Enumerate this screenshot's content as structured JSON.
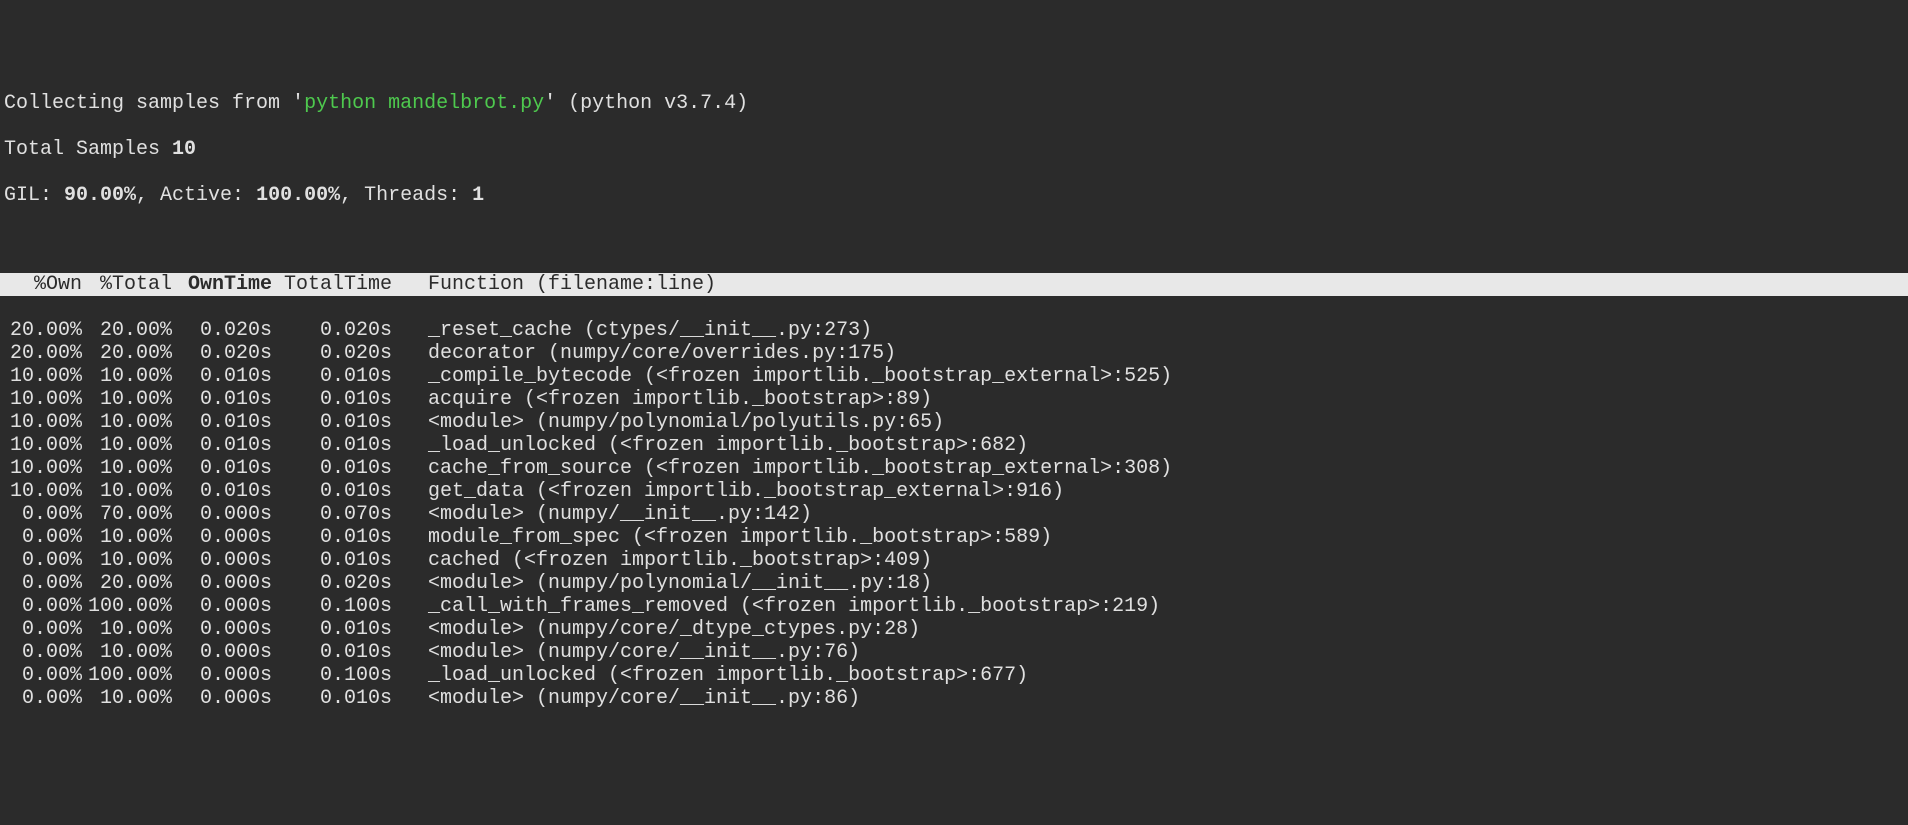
{
  "header": {
    "prefix": "Collecting samples from '",
    "command": "python mandelbrot.py",
    "suffix": "' (python v3.7.4)",
    "total_samples_label": "Total Samples ",
    "total_samples": "10",
    "gil_label": "GIL: ",
    "gil": "90.00%",
    "active_label": ", Active: ",
    "active": "100.00%",
    "threads_label": ", Threads: ",
    "threads": "1"
  },
  "columns": {
    "own": "%Own",
    "total": "%Total",
    "owntime": "OwnTime",
    "totaltime": "TotalTime",
    "function": "Function (filename:line)"
  },
  "rows": [
    {
      "own": "20.00%",
      "total": "20.00%",
      "owntime": "0.020s",
      "totaltime": "0.020s",
      "func": "_reset_cache (ctypes/__init__.py:273)"
    },
    {
      "own": "20.00%",
      "total": "20.00%",
      "owntime": "0.020s",
      "totaltime": "0.020s",
      "func": "decorator (numpy/core/overrides.py:175)"
    },
    {
      "own": "10.00%",
      "total": "10.00%",
      "owntime": "0.010s",
      "totaltime": "0.010s",
      "func": "_compile_bytecode (<frozen importlib._bootstrap_external>:525)"
    },
    {
      "own": "10.00%",
      "total": "10.00%",
      "owntime": "0.010s",
      "totaltime": "0.010s",
      "func": "acquire (<frozen importlib._bootstrap>:89)"
    },
    {
      "own": "10.00%",
      "total": "10.00%",
      "owntime": "0.010s",
      "totaltime": "0.010s",
      "func": "<module> (numpy/polynomial/polyutils.py:65)"
    },
    {
      "own": "10.00%",
      "total": "10.00%",
      "owntime": "0.010s",
      "totaltime": "0.010s",
      "func": "_load_unlocked (<frozen importlib._bootstrap>:682)"
    },
    {
      "own": "10.00%",
      "total": "10.00%",
      "owntime": "0.010s",
      "totaltime": "0.010s",
      "func": "cache_from_source (<frozen importlib._bootstrap_external>:308)"
    },
    {
      "own": "10.00%",
      "total": "10.00%",
      "owntime": "0.010s",
      "totaltime": "0.010s",
      "func": "get_data (<frozen importlib._bootstrap_external>:916)"
    },
    {
      "own": "0.00%",
      "total": "70.00%",
      "owntime": "0.000s",
      "totaltime": "0.070s",
      "func": "<module> (numpy/__init__.py:142)"
    },
    {
      "own": "0.00%",
      "total": "10.00%",
      "owntime": "0.000s",
      "totaltime": "0.010s",
      "func": "module_from_spec (<frozen importlib._bootstrap>:589)"
    },
    {
      "own": "0.00%",
      "total": "10.00%",
      "owntime": "0.000s",
      "totaltime": "0.010s",
      "func": "cached (<frozen importlib._bootstrap>:409)"
    },
    {
      "own": "0.00%",
      "total": "20.00%",
      "owntime": "0.000s",
      "totaltime": "0.020s",
      "func": "<module> (numpy/polynomial/__init__.py:18)"
    },
    {
      "own": "0.00%",
      "total": "100.00%",
      "owntime": "0.000s",
      "totaltime": "0.100s",
      "func": "_call_with_frames_removed (<frozen importlib._bootstrap>:219)"
    },
    {
      "own": "0.00%",
      "total": "10.00%",
      "owntime": "0.000s",
      "totaltime": "0.010s",
      "func": "<module> (numpy/core/_dtype_ctypes.py:28)"
    },
    {
      "own": "0.00%",
      "total": "10.00%",
      "owntime": "0.000s",
      "totaltime": "0.010s",
      "func": "<module> (numpy/core/__init__.py:76)"
    },
    {
      "own": "0.00%",
      "total": "100.00%",
      "owntime": "0.000s",
      "totaltime": "0.100s",
      "func": "_load_unlocked (<frozen importlib._bootstrap>:677)"
    },
    {
      "own": "0.00%",
      "total": "10.00%",
      "owntime": "0.000s",
      "totaltime": "0.010s",
      "func": "<module> (numpy/core/__init__.py:86)"
    }
  ]
}
